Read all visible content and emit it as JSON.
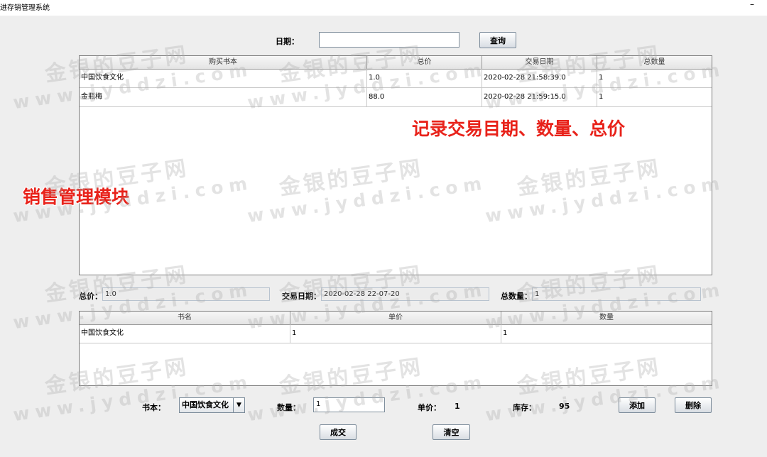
{
  "window": {
    "title": "进存销管理系统",
    "minimize": "–"
  },
  "query": {
    "date_label": "日期：",
    "date_value": "",
    "query_button": "查询"
  },
  "sales_table": {
    "columns": [
      "购买书本",
      "总价",
      "交易日期",
      "总数量"
    ],
    "rows": [
      [
        "中国饮食文化",
        "1.0",
        "2020-02-28 21:58:39.0",
        "1"
      ],
      [
        "金瓶梅",
        "88.0",
        "2020-02-28 21:59:15.0",
        "1"
      ]
    ]
  },
  "summary": {
    "total_price_label": "总价：",
    "total_price_value": "1.0",
    "trade_date_label": "交易日期：",
    "trade_date_value": "2020-02-28 22-07-20",
    "total_qty_label": "总数量：",
    "total_qty_value": "1"
  },
  "cart_table": {
    "columns": [
      "书名",
      "单价",
      "数量"
    ],
    "rows": [
      [
        "中国饮食文化",
        "1",
        "1"
      ]
    ]
  },
  "controls": {
    "book_label": "书本：",
    "book_selected": "中国饮食文化",
    "qty_label": "数量：",
    "qty_value": "1",
    "price_label": "单价：",
    "price_value": "1",
    "stock_label": "库存：",
    "stock_value": "95",
    "add_button": "添加",
    "delete_button": "删除",
    "deal_button": "成交",
    "clear_button": "清空"
  },
  "annotations": {
    "record_note": "记录交易目期、数量、总价",
    "module_note": "销售管理模块"
  },
  "watermark": {
    "cn": "金银的豆子网",
    "url": "www.jyddzi.com"
  },
  "icons": {
    "dropdown": "chevron-down-icon"
  }
}
